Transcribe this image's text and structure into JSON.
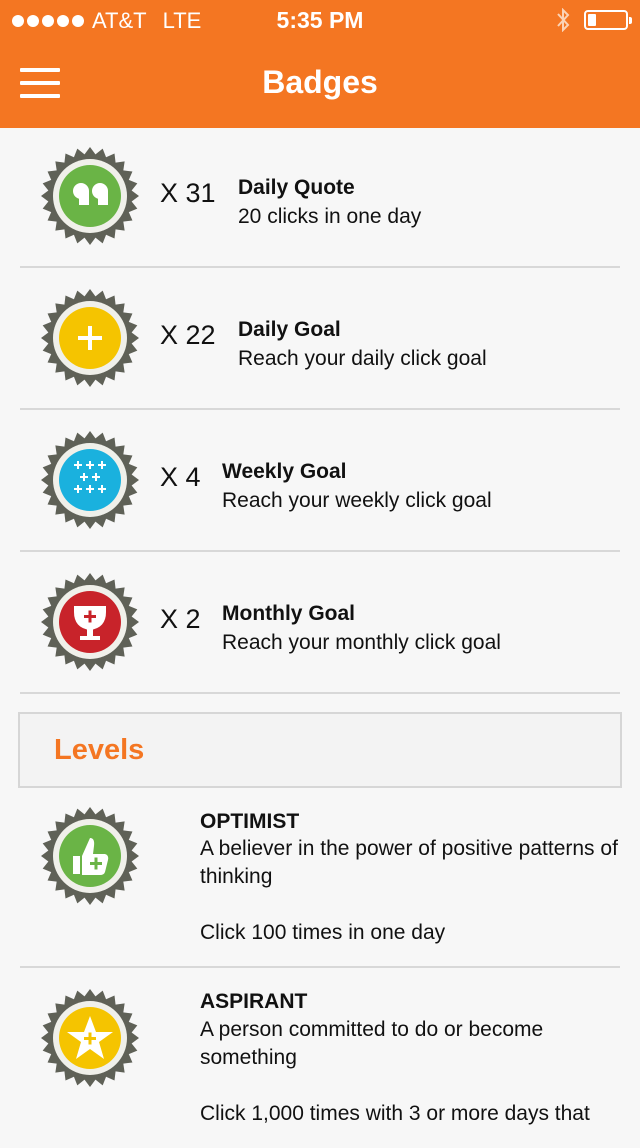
{
  "status_bar": {
    "carrier": "AT&T",
    "network": "LTE",
    "time": "5:35 PM"
  },
  "nav": {
    "title": "Badges"
  },
  "badges": [
    {
      "count": "X 31",
      "title": "Daily Quote",
      "description": "20 clicks in one day",
      "icon": "quote-icon",
      "color": "#6ab446"
    },
    {
      "count": "X 22",
      "title": "Daily Goal",
      "description": "Reach your daily click goal",
      "icon": "plus-icon",
      "color": "#f5c400"
    },
    {
      "count": "X 4",
      "title": "Weekly Goal",
      "description": "Reach your weekly click goal",
      "icon": "plus-grid-icon",
      "color": "#1ab1de"
    },
    {
      "count": "X 2",
      "title": "Monthly Goal",
      "description": "Reach your monthly click goal",
      "icon": "trophy-icon",
      "color": "#c8232a"
    }
  ],
  "levels": {
    "heading": "Levels",
    "items": [
      {
        "title": "OPTIMIST",
        "description": "A believer in the power of positive patterns of thinking",
        "requirement": "Click 100 times in one day",
        "icon": "thumbs-up-icon",
        "color": "#6ab446"
      },
      {
        "title": "ASPIRANT",
        "description": "A person committed to do or become something",
        "requirement": "Click 1,000 times with 3 or more days that",
        "icon": "star-icon",
        "color": "#f5c400"
      }
    ]
  },
  "colors": {
    "brand": "#f47622",
    "seal": "#5f6157"
  }
}
